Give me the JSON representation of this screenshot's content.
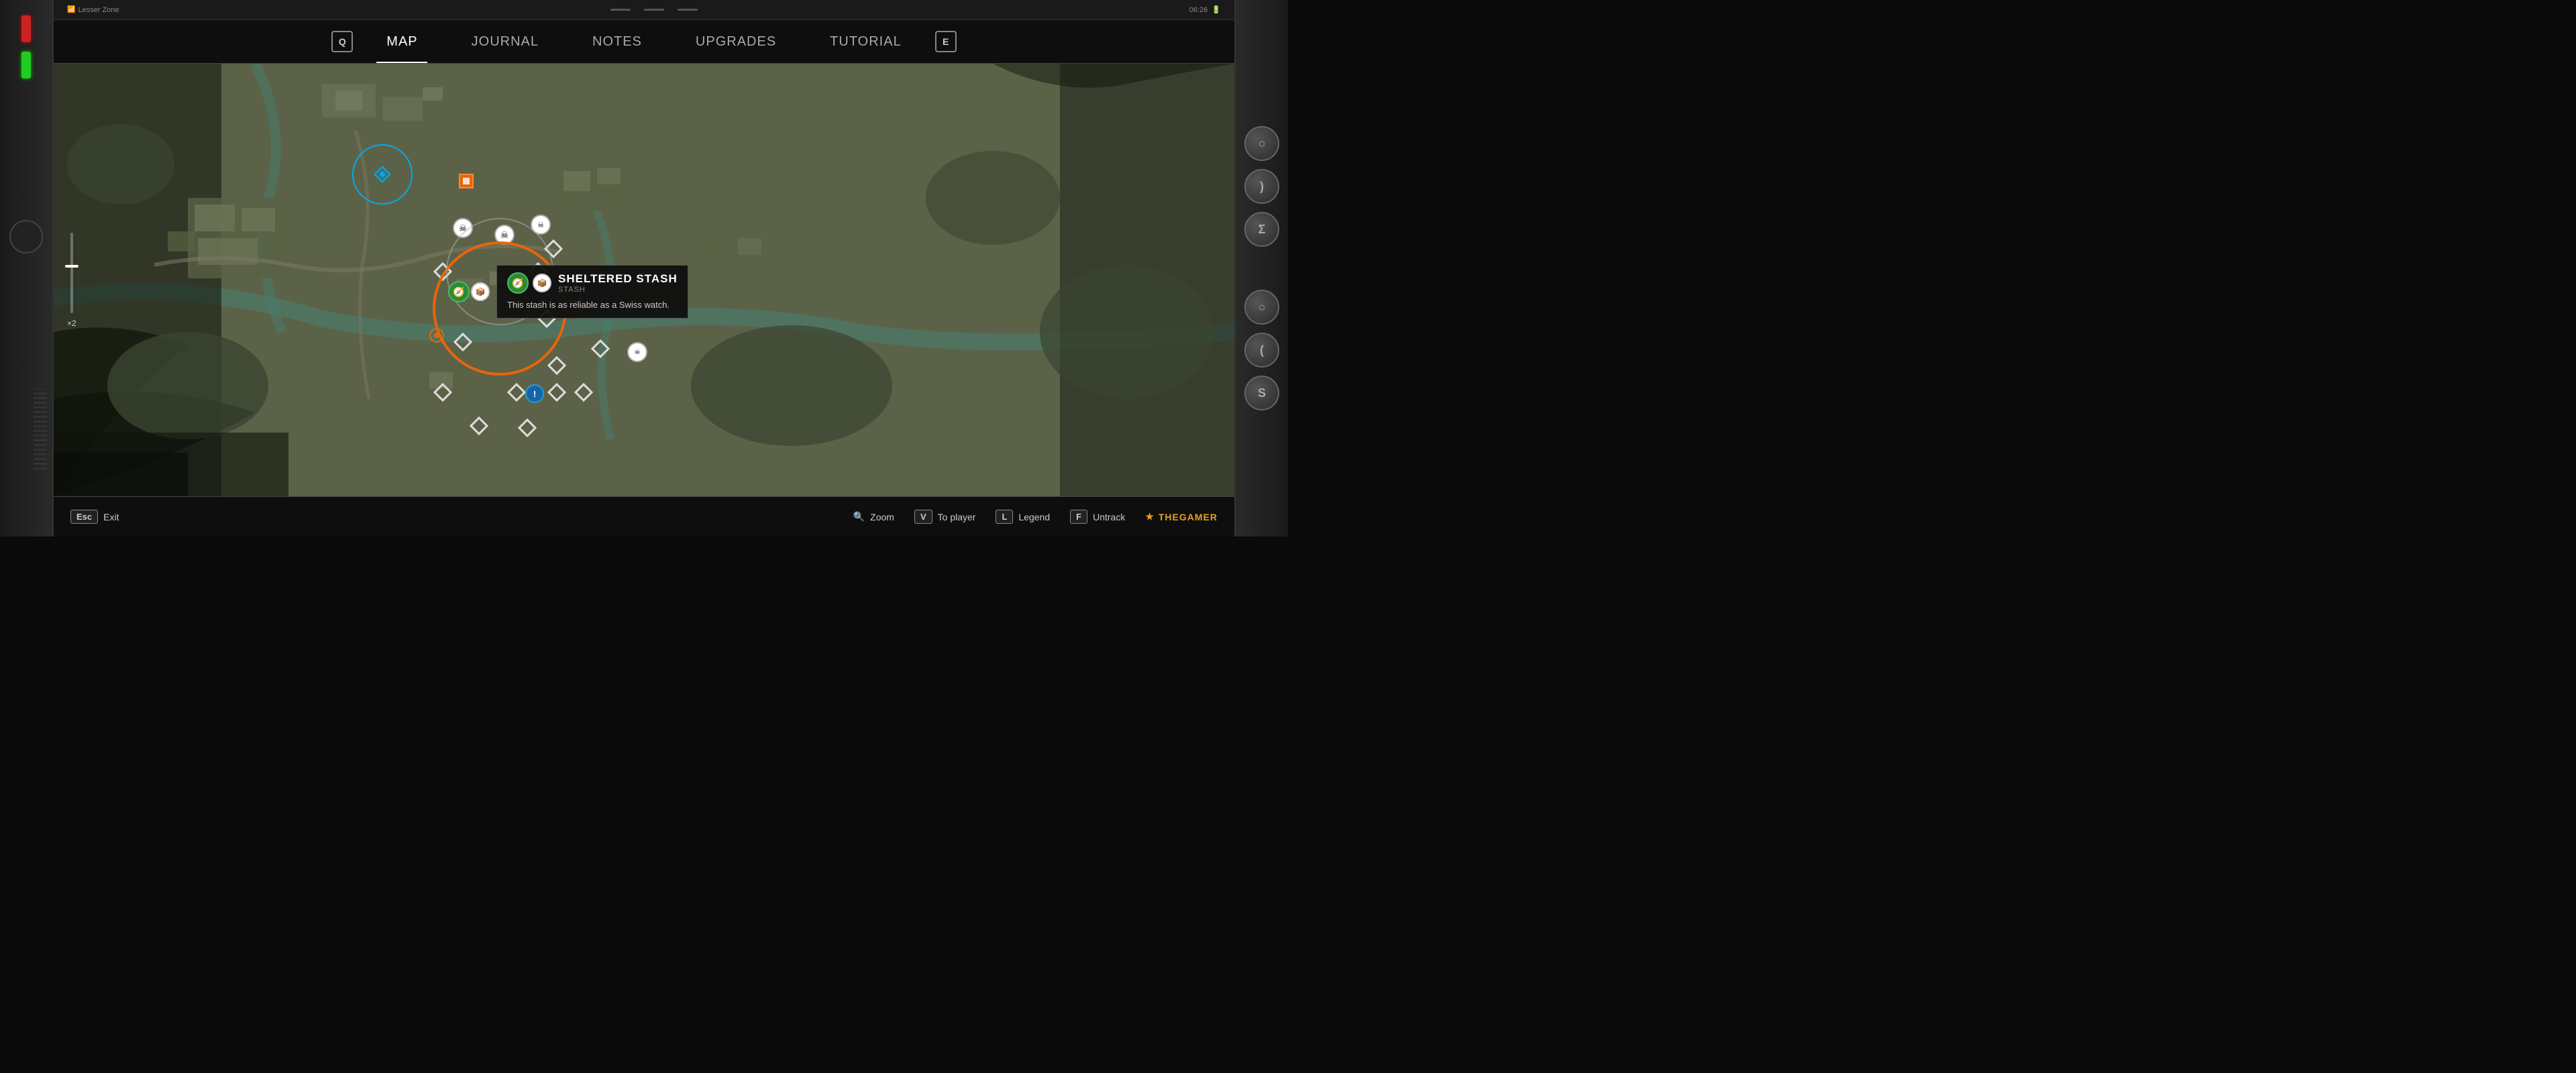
{
  "topbar": {
    "signal_label": "Lesser Zone",
    "time": "06:26",
    "battery_icon": "battery-icon"
  },
  "nav": {
    "left_key": "Q",
    "right_key": "E",
    "tabs": [
      {
        "id": "map",
        "label": "Map",
        "active": true
      },
      {
        "id": "journal",
        "label": "Journal",
        "active": false
      },
      {
        "id": "notes",
        "label": "Notes",
        "active": false
      },
      {
        "id": "upgrades",
        "label": "Upgrades",
        "active": false
      },
      {
        "id": "tutorial",
        "label": "Tutorial",
        "active": false
      }
    ]
  },
  "map": {
    "zoom_label": "×2",
    "tooltip": {
      "title": "SHELTERED STASH",
      "subtitle": "STASH",
      "description": "This stash is as reliable as a Swiss watch.",
      "player_icon": "🧭",
      "stash_icon": "📦"
    }
  },
  "right_buttons": [
    {
      "id": "btn1",
      "label": "○"
    },
    {
      "id": "btn2",
      "label": ")"
    },
    {
      "id": "btn3",
      "label": "Σ"
    },
    {
      "id": "btn4",
      "label": "○"
    },
    {
      "id": "btn5",
      "label": "("
    },
    {
      "id": "btn6",
      "label": "S"
    }
  ],
  "bottom_bar": {
    "esc_label": "Esc",
    "exit_label": "Exit",
    "zoom_icon": "🔍",
    "zoom_label": "Zoom",
    "v_key": "V",
    "to_player_label": "To player",
    "l_key": "L",
    "legend_label": "Legend",
    "f_key": "F",
    "untrack_label": "Untrack",
    "brand_star": "★",
    "brand_name": "THEGAMER"
  }
}
